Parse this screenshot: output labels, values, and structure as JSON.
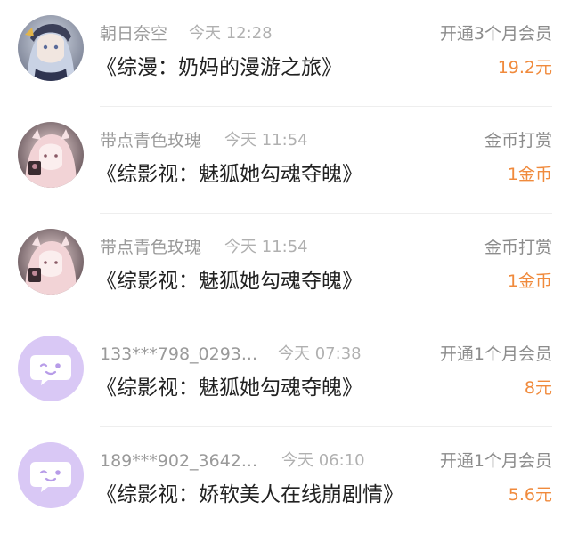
{
  "items": [
    {
      "name": "朝日奈空",
      "time": "今天 12:28",
      "type": "开通3个月会员",
      "title": "《综漫：奶妈的漫游之旅》",
      "amount": "19.2元",
      "avatar": "anime-avatar-silver-hair"
    },
    {
      "name": "带点青色玫瑰",
      "time": "今天 11:54",
      "type": "金币打赏",
      "title": "《综影视：魅狐她勾魂夺魄》",
      "amount": "1金币",
      "avatar": "anime-avatar-pink-hair"
    },
    {
      "name": "带点青色玫瑰",
      "time": "今天 11:54",
      "type": "金币打赏",
      "title": "《综影视：魅狐她勾魂夺魄》",
      "amount": "1金币",
      "avatar": "anime-avatar-pink-hair"
    },
    {
      "name": "133***798_0293...",
      "time": "今天 07:38",
      "type": "开通1个月会员",
      "title": "《综影视：魅狐她勾魂夺魄》",
      "amount": "8元",
      "avatar": "default-chat-bubble-avatar"
    },
    {
      "name": "189***902_3642...",
      "time": "今天 06:10",
      "type": "开通1个月会员",
      "title": "《综影视：娇软美人在线崩剧情》",
      "amount": "5.6元",
      "avatar": "default-chat-bubble-avatar"
    }
  ],
  "colors": {
    "amount": "#f08a3c",
    "name": "#9a9a9a",
    "title": "#222222",
    "default_avatar_bg": "#d9c8f5"
  }
}
